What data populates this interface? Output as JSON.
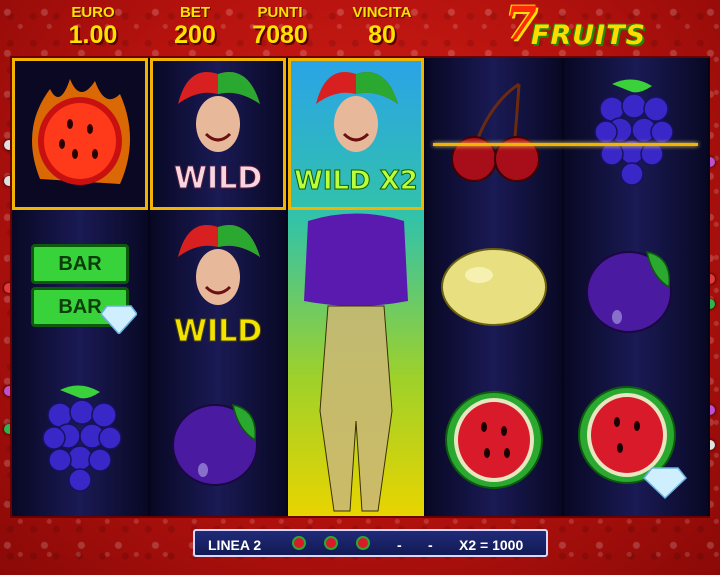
{
  "hud": {
    "euro": {
      "label": "EURO",
      "value": "1.00"
    },
    "bet": {
      "label": "BET",
      "value": "200"
    },
    "punti": {
      "label": "PUNTI",
      "value": "7080"
    },
    "vincita": {
      "label": "VINCITA",
      "value": "80"
    }
  },
  "logo": {
    "seven": "7",
    "fruits": "FRUITS"
  },
  "reels": [
    [
      "flaming-watermelon",
      "bar-bar-diamond",
      "grapes"
    ],
    [
      "joker-wild",
      "joker-wild",
      "plum"
    ],
    [
      "joker-wild-x2-expanded",
      "joker-wild-x2-expanded",
      "joker-wild-x2-expanded"
    ],
    [
      "cherries",
      "lemon",
      "watermelon"
    ],
    [
      "grapes",
      "plum",
      "watermelon-diamond"
    ]
  ],
  "symbols": {
    "wild": "WILD",
    "wild2": "WILD",
    "wild_x2": "WILD X2",
    "bar_top": "BAR",
    "bar_bottom": "BAR"
  },
  "footer": {
    "line": "LINEA 2",
    "dash1": "-",
    "dash2": "-",
    "win": "X2 = 1000"
  },
  "colors": {
    "background": "#c8150f",
    "hud_text": "#ffe200",
    "win_frame": "#f2b400",
    "footer_bg": "#1a2266"
  }
}
